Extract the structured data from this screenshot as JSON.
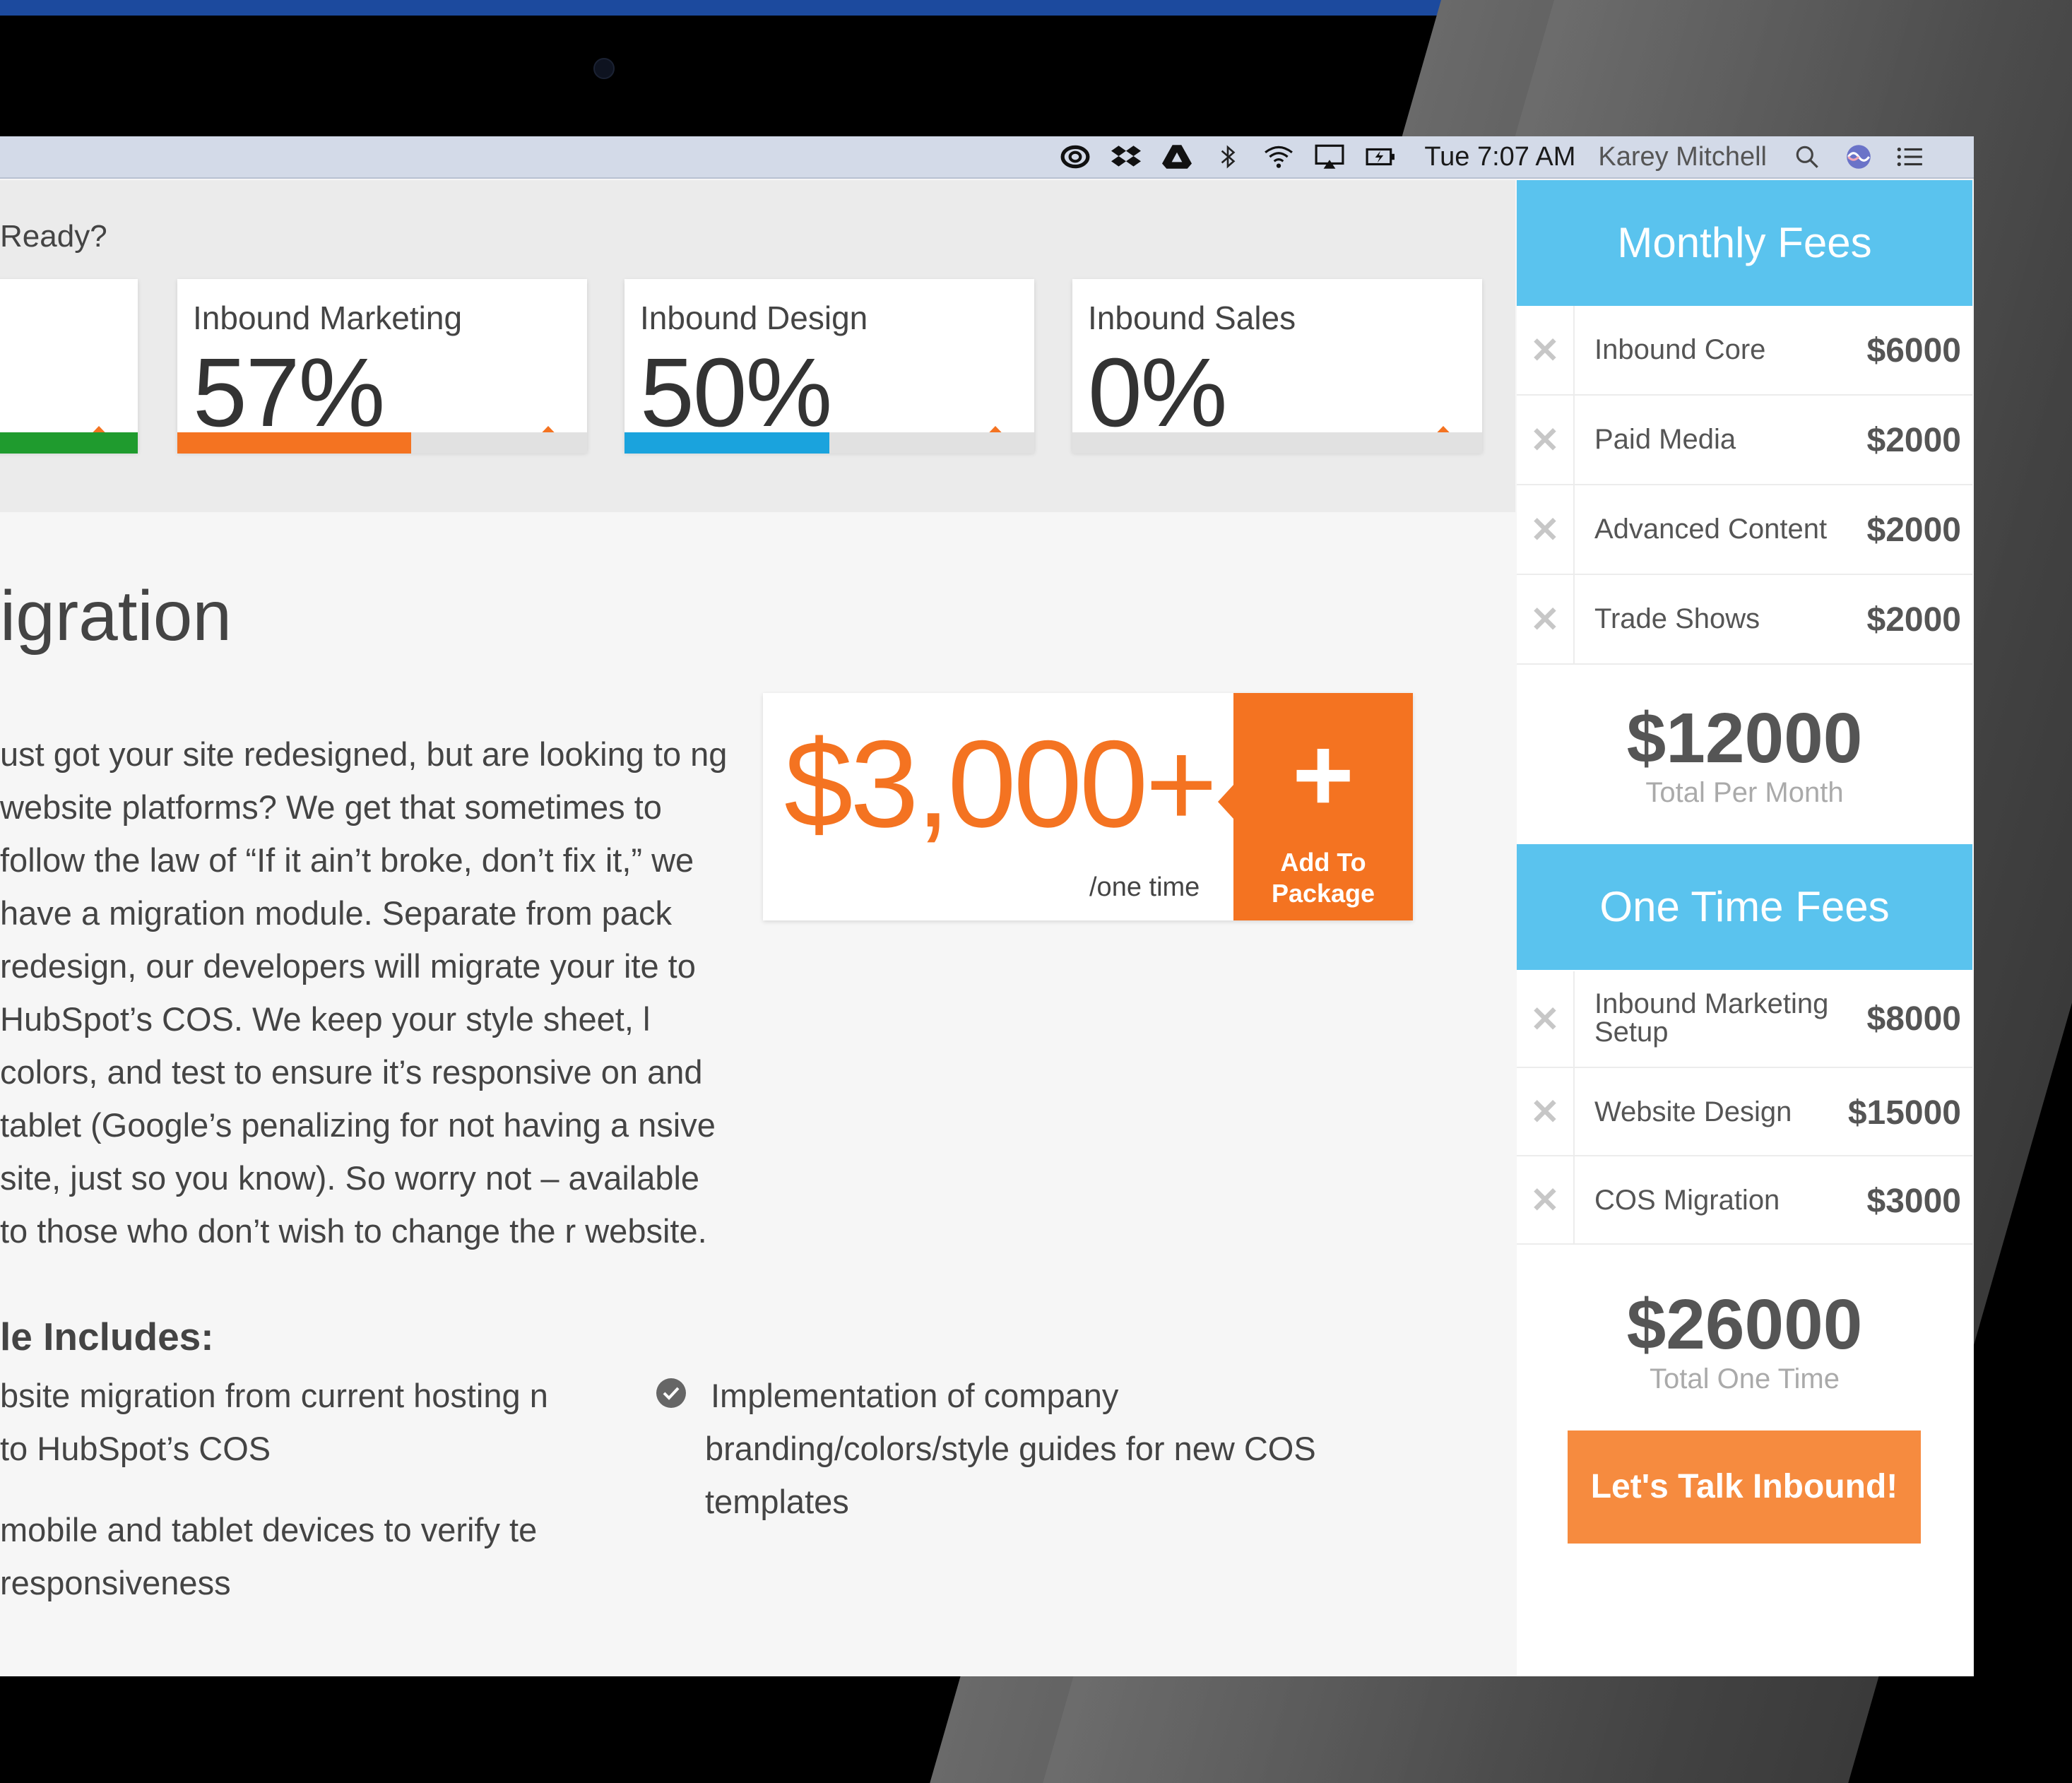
{
  "menubar": {
    "time": "Tue 7:07 AM",
    "user": "Karey Mitchell",
    "icons": [
      "creative-cloud-icon",
      "dropbox-icon",
      "google-drive-icon",
      "bluetooth-icon",
      "wifi-icon",
      "airplay-icon",
      "battery-icon",
      "spotlight-search-icon",
      "siri-icon",
      "notification-center-icon"
    ]
  },
  "ready": {
    "label": "Ready?"
  },
  "cards": [
    {
      "title": "",
      "pct": "",
      "percent_value": 100,
      "color": "#1f9b2e"
    },
    {
      "title": "Inbound Marketing",
      "pct": "57%",
      "percent_value": 57,
      "color": "#f47321"
    },
    {
      "title": "Inbound Design",
      "pct": "50%",
      "percent_value": 50,
      "color": "#1aa3dd"
    },
    {
      "title": "Inbound Sales",
      "pct": "0%",
      "percent_value": 0,
      "color": "#e1e1e1"
    }
  ],
  "module": {
    "heading": "igration",
    "body": "ust got your site redesigned, but are looking to ng website platforms? We get that sometimes to follow the law of “If it ain’t broke, don’t fix it,” we have a migration module. Separate from pack redesign, our developers will migrate your ite to HubSpot’s COS. We keep your style sheet, l colors, and test to ensure it’s responsive on and tablet (Google’s penalizing for not having a nsive site, just so you know). So worry not – available to those who don’t wish to change the r website.",
    "price": "$3,000+",
    "price_unit": "/one time",
    "add_plus": "+",
    "add_label_line1": "Add To",
    "add_label_line2": "Package",
    "includes_title": "le Includes:",
    "include_items": [
      "bsite migration from current hosting n to HubSpot’s COS",
      "mobile and tablet devices to verify te responsiveness",
      "Implementation of company branding/colors/style guides for new COS templates"
    ]
  },
  "sidebar": {
    "monthly_title": "Monthly Fees",
    "monthly": [
      {
        "name": "Inbound Core",
        "amount": "$6000"
      },
      {
        "name": "Paid Media",
        "amount": "$2000"
      },
      {
        "name": "Advanced Content",
        "amount": "$2000"
      },
      {
        "name": "Trade Shows",
        "amount": "$2000"
      }
    ],
    "monthly_total": "$12000",
    "monthly_total_label": "Total Per Month",
    "onetime_title": "One Time Fees",
    "onetime": [
      {
        "name_line1": "Inbound Marketing",
        "name_line2": "Setup",
        "amount": "$8000"
      },
      {
        "name_line1": "Website Design",
        "name_line2": "",
        "amount": "$15000"
      },
      {
        "name_line1": "COS Migration",
        "name_line2": "",
        "amount": "$3000"
      }
    ],
    "onetime_total": "$26000",
    "onetime_total_label": "Total One Time",
    "remove_glyph": "✕",
    "cta": "Let's Talk Inbound!"
  },
  "colors": {
    "accent": "#f47321",
    "sidebar_header": "#5ac3ee",
    "cta": "#f68b3f"
  }
}
